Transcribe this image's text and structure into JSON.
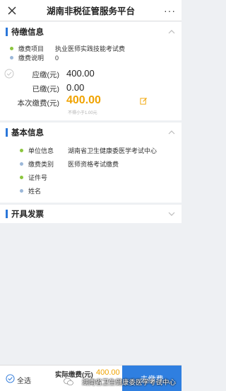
{
  "header": {
    "title": "湖南非税征管服务平台",
    "more_label": "···"
  },
  "pending": {
    "title": "待缴信息",
    "fee_item_label": "缴费项目",
    "fee_item_value": "执业医师实践技能考试费",
    "fee_note_label": "缴费说明",
    "fee_note_value": "0",
    "due_label": "应缴(元)",
    "due_value": "400.00",
    "paid_label": "已缴(元)",
    "paid_value": "0.00",
    "this_label": "本次缴费(元)",
    "this_value": "400.00",
    "this_hint": "不得小于1.00元"
  },
  "basic": {
    "title": "基本信息",
    "unit_label": "单位信息",
    "unit_value": "湖南省卫生健康委医学考试中心",
    "type_label": "缴费类别",
    "type_value": "医师资格考试缴费",
    "id_label": "证件号",
    "id_value": "",
    "name_label": "姓名",
    "name_value": ""
  },
  "invoice": {
    "title": "开具发票"
  },
  "footer": {
    "select_all_label": "全选",
    "actual_label": "实际缴费(元)",
    "actual_value": "400.00",
    "pay_label": "去缴费",
    "watermark": "湖南省卫生健康委医学考试中心"
  },
  "colors": {
    "accent": "#2b77d9",
    "amount": "#f0a300",
    "dot_green": "#8cc63f",
    "dot_blue": "#9cb8d9"
  }
}
